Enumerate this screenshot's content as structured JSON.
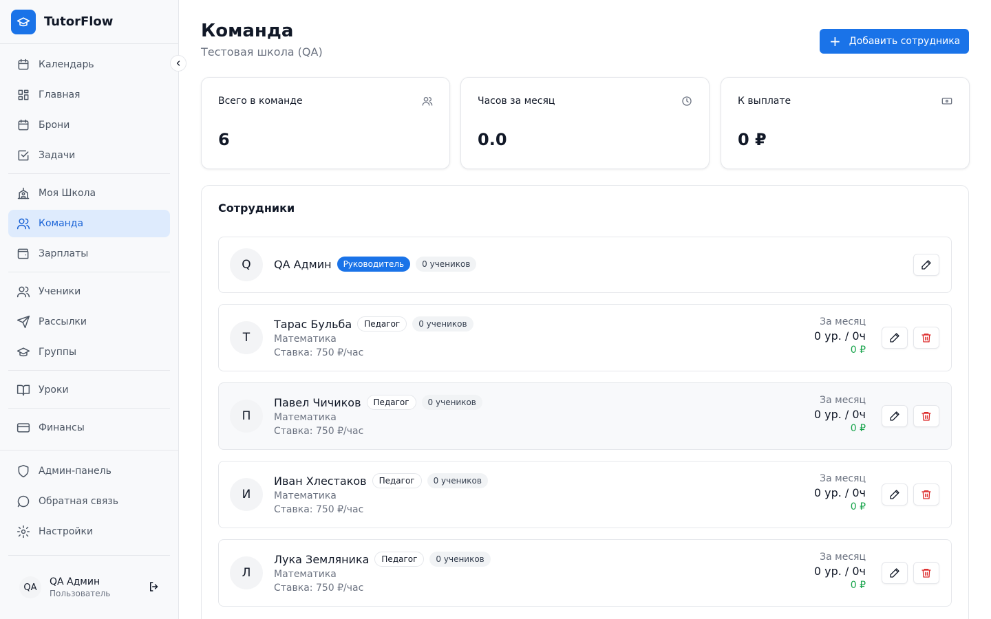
{
  "app": {
    "name": "TutorFlow"
  },
  "sidebar": {
    "groups": [
      [
        {
          "label": "Календарь",
          "icon": "calendar-icon"
        },
        {
          "label": "Главная",
          "icon": "dashboard-icon"
        },
        {
          "label": "Брони",
          "icon": "calendar-icon"
        },
        {
          "label": "Задачи",
          "icon": "checkbox-icon"
        }
      ],
      [
        {
          "label": "Моя Школа",
          "icon": "school-icon"
        },
        {
          "label": "Команда",
          "icon": "users-icon",
          "active": true
        },
        {
          "label": "Зарплаты",
          "icon": "wallet-icon"
        }
      ],
      [
        {
          "label": "Ученики",
          "icon": "users-icon"
        },
        {
          "label": "Рассылки",
          "icon": "send-icon"
        },
        {
          "label": "Группы",
          "icon": "graduation-cap-icon"
        }
      ],
      [
        {
          "label": "Уроки",
          "icon": "book-icon"
        }
      ],
      [
        {
          "label": "Финансы",
          "icon": "credit-card-icon"
        }
      ]
    ],
    "bottom": [
      {
        "label": "Админ-панель",
        "icon": "shield-icon"
      },
      {
        "label": "Обратная связь",
        "icon": "chat-icon"
      },
      {
        "label": "Настройки",
        "icon": "gear-icon"
      }
    ],
    "user": {
      "initials": "QA",
      "name": "QA Админ",
      "role": "Пользователь"
    }
  },
  "header": {
    "title": "Команда",
    "subtitle": "Тестовая школа (QA)",
    "add_button": "Добавить сотрудника"
  },
  "stats": [
    {
      "label": "Всего в команде",
      "value": "6",
      "icon": "users-icon"
    },
    {
      "label": "Часов за месяц",
      "value": "0.0",
      "icon": "clock-icon"
    },
    {
      "label": "К выплате",
      "value": "0 ₽",
      "icon": "banknote-icon"
    }
  ],
  "staff": {
    "title": "Сотрудники",
    "members": [
      {
        "initial": "Q",
        "name": "QA Админ",
        "role": "Руководитель",
        "role_style": "primary",
        "students": "0 учеников"
      },
      {
        "initial": "Т",
        "name": "Тарас Бульба",
        "role": "Педагог",
        "role_style": "outline",
        "students": "0 учеников",
        "subject": "Математика",
        "rate": "Ставка: 750 ₽/час",
        "month_label": "За месяц",
        "month_value": "0 ур. / 0ч",
        "month_pay": "0 ₽"
      },
      {
        "initial": "П",
        "name": "Павел Чичиков",
        "role": "Педагог",
        "role_style": "outline",
        "students": "0 учеников",
        "subject": "Математика",
        "rate": "Ставка: 750 ₽/час",
        "month_label": "За месяц",
        "month_value": "0 ур. / 0ч",
        "month_pay": "0 ₽"
      },
      {
        "initial": "И",
        "name": "Иван Хлестаков",
        "role": "Педагог",
        "role_style": "outline",
        "students": "0 учеников",
        "subject": "Математика",
        "rate": "Ставка: 750 ₽/час",
        "month_label": "За месяц",
        "month_value": "0 ур. / 0ч",
        "month_pay": "0 ₽"
      },
      {
        "initial": "Л",
        "name": "Лука Земляника",
        "role": "Педагог",
        "role_style": "outline",
        "students": "0 учеников",
        "subject": "Математика",
        "rate": "Ставка: 750 ₽/час",
        "month_label": "За месяц",
        "month_value": "0 ур. / 0ч",
        "month_pay": "0 ₽"
      }
    ]
  },
  "colors": {
    "accent": "#1a73e8",
    "active_bg": "#deebfd",
    "success": "#16a34a",
    "danger": "#dc2626"
  }
}
